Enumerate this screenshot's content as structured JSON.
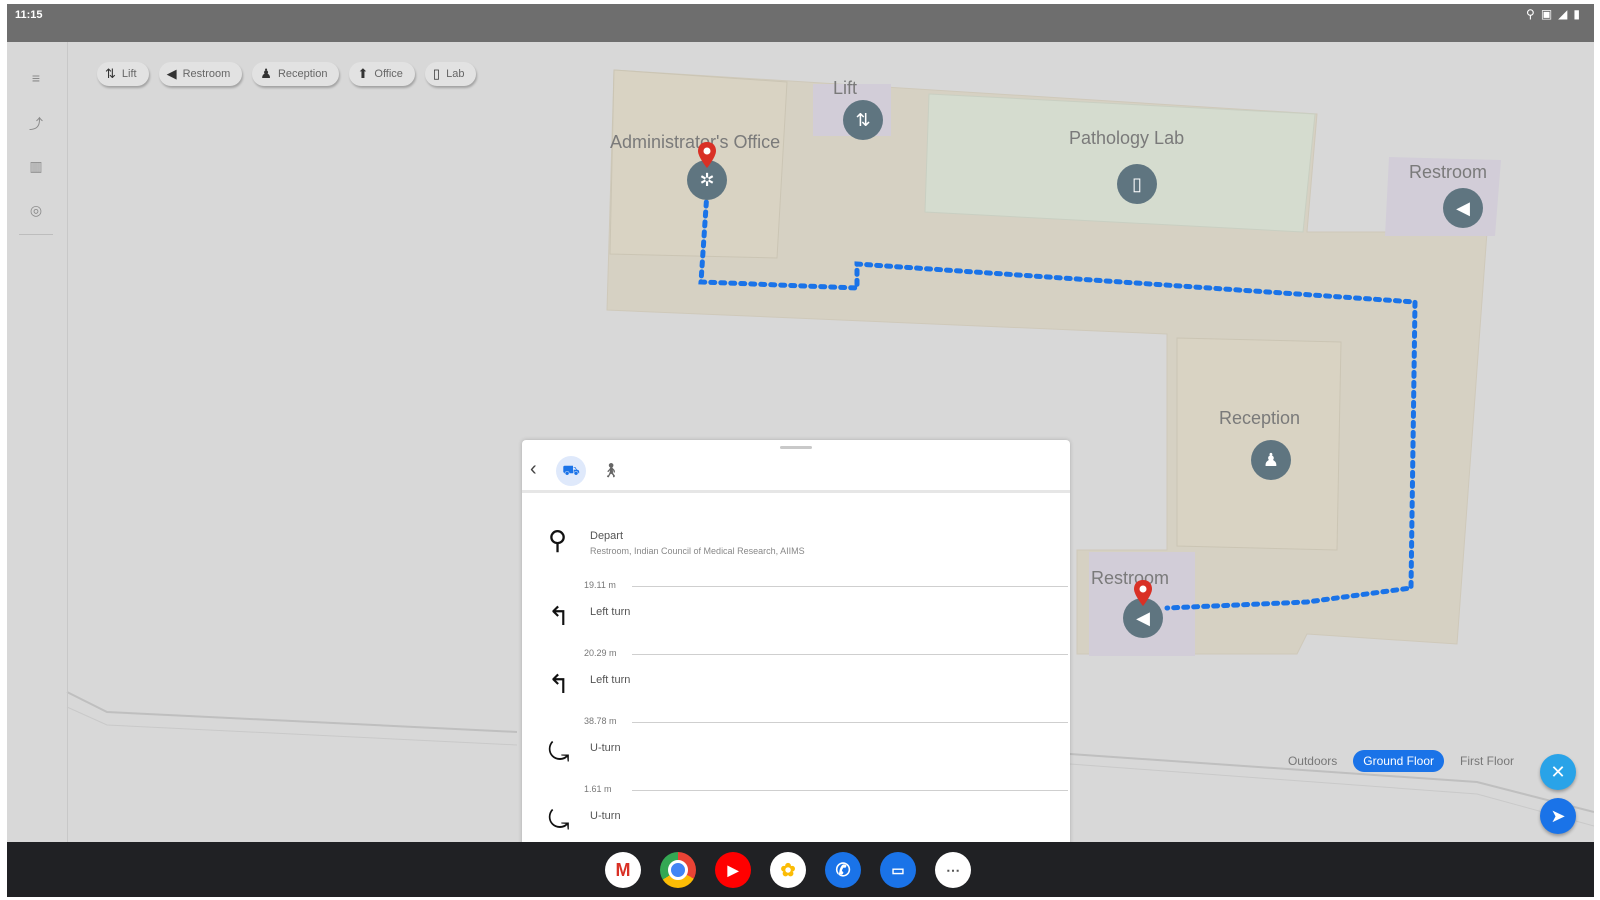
{
  "statusbar": {
    "time": "11:15",
    "icons": [
      "location-icon",
      "network-icon",
      "wifi-icon",
      "battery-icon"
    ]
  },
  "rail": {
    "items": [
      "menu-icon",
      "route-icon",
      "building-icon",
      "settings-icon"
    ]
  },
  "chips": [
    {
      "icon": "lift-icon",
      "label": "Lift"
    },
    {
      "icon": "restroom-icon",
      "label": "Restroom"
    },
    {
      "icon": "reception-icon",
      "label": "Reception"
    },
    {
      "icon": "office-icon",
      "label": "Office"
    },
    {
      "icon": "lab-icon",
      "label": "Lab"
    }
  ],
  "map": {
    "rooms": {
      "admin": "Administrator's Office",
      "lift": "Lift",
      "pathology": "Pathology Lab",
      "restroom_top": "Restroom",
      "reception": "Reception",
      "restroom_bottom": "Restroom"
    },
    "route_color": "#1a73e8",
    "pin_color": "#d93025",
    "poi_color": "#5f7580"
  },
  "floors": {
    "items": [
      "Outdoors",
      "Ground Floor",
      "First Floor"
    ],
    "active": "Ground Floor"
  },
  "sheet": {
    "modes": [
      "car-icon",
      "walk-icon"
    ],
    "active_mode": "car-icon",
    "steps": [
      {
        "icon": "pin-icon",
        "title": "Depart",
        "subtitle": "Restroom, Indian Council of Medical Research, AIIMS"
      },
      {
        "icon": "turn-left-icon",
        "title": "Left turn"
      },
      {
        "icon": "turn-left-icon",
        "title": "Left turn"
      },
      {
        "icon": "u-turn-icon",
        "title": "U-turn"
      },
      {
        "icon": "u-turn-icon",
        "title": "U-turn"
      }
    ],
    "distances": [
      "19.11 m",
      "20.29 m",
      "38.78 m",
      "1.61 m"
    ]
  },
  "dock": {
    "apps": [
      "Gmail",
      "Chrome",
      "YouTube",
      "Photos",
      "Phone",
      "Messages",
      "Apps"
    ]
  }
}
